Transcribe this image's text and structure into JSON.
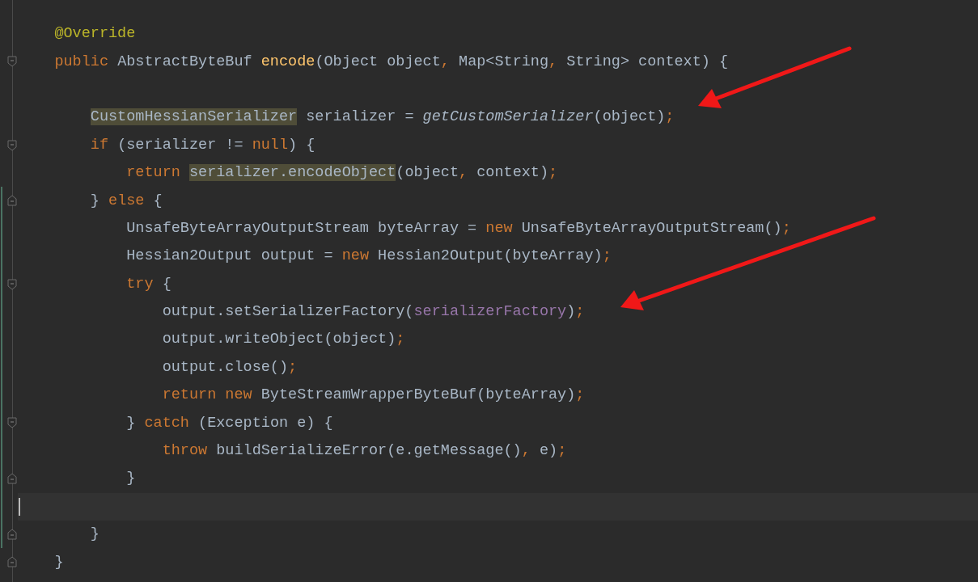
{
  "editor": {
    "lines": [
      {
        "fold_open": false,
        "fold_close": false,
        "changed": false,
        "current": false,
        "tokens": [
          {
            "text": "@Override",
            "kind": "annotation"
          }
        ]
      },
      {
        "fold_open": true,
        "fold_close": false,
        "changed": false,
        "current": false,
        "tokens": [
          {
            "text": "public ",
            "kind": "keyword"
          },
          {
            "text": "AbstractByteBuf ",
            "kind": "plain"
          },
          {
            "text": "encode",
            "kind": "declaration"
          },
          {
            "text": "(Object object",
            "kind": "plain"
          },
          {
            "text": ", ",
            "kind": "keyword"
          },
          {
            "text": "Map<String",
            "kind": "plain"
          },
          {
            "text": ", ",
            "kind": "keyword"
          },
          {
            "text": "String> context) {",
            "kind": "plain"
          }
        ],
        "children": [
          {
            "fold_open": false,
            "fold_close": false,
            "changed": false,
            "current": false
          },
          {
            "fold_open": false,
            "fold_close": false,
            "changed": false,
            "current": false,
            "tokens": [
              {
                "text": "CustomHessianSerializer",
                "kind": "usage"
              },
              {
                "text": " serializer = ",
                "kind": "plain"
              },
              {
                "text": "getCustomSerializer",
                "kind": "static"
              },
              {
                "text": "(object)",
                "kind": "plain"
              },
              {
                "text": ";",
                "kind": "keyword"
              }
            ]
          },
          {
            "fold_open": true,
            "fold_close": false,
            "changed": false,
            "current": false,
            "tokens": [
              {
                "text": "if ",
                "kind": "keyword"
              },
              {
                "text": "(serializer != ",
                "kind": "plain"
              },
              {
                "text": "null",
                "kind": "keyword"
              },
              {
                "text": ") {",
                "kind": "plain"
              }
            ],
            "children": [
              {
                "fold_open": false,
                "fold_close": false,
                "changed": false,
                "current": false,
                "tokens": [
                  {
                    "text": "return ",
                    "kind": "keyword"
                  },
                  {
                    "text": "serializer.encodeObject",
                    "kind": "usage"
                  },
                  {
                    "text": "(object",
                    "kind": "plain"
                  },
                  {
                    "text": ", ",
                    "kind": "keyword"
                  },
                  {
                    "text": "context)",
                    "kind": "plain"
                  },
                  {
                    "text": ";",
                    "kind": "keyword"
                  }
                ]
              }
            ]
          },
          {
            "fold_open": false,
            "fold_close": true,
            "changed": true,
            "current": false,
            "tokens": [
              {
                "text": "} ",
                "kind": "plain"
              },
              {
                "text": "else ",
                "kind": "keyword"
              },
              {
                "text": "{",
                "kind": "plain"
              }
            ],
            "children": [
              {
                "fold_open": false,
                "fold_close": false,
                "changed": true,
                "current": false,
                "tokens": [
                  {
                    "text": "UnsafeByteArrayOutputStream byteArray = ",
                    "kind": "plain"
                  },
                  {
                    "text": "new ",
                    "kind": "keyword"
                  },
                  {
                    "text": "UnsafeByteArrayOutputStream()",
                    "kind": "plain"
                  },
                  {
                    "text": ";",
                    "kind": "keyword"
                  }
                ]
              },
              {
                "fold_open": false,
                "fold_close": false,
                "changed": true,
                "current": false,
                "tokens": [
                  {
                    "text": "Hessian2Output output = ",
                    "kind": "plain"
                  },
                  {
                    "text": "new ",
                    "kind": "keyword"
                  },
                  {
                    "text": "Hessian2Output(byteArray)",
                    "kind": "plain"
                  },
                  {
                    "text": ";",
                    "kind": "keyword"
                  }
                ]
              },
              {
                "fold_open": true,
                "fold_close": false,
                "changed": true,
                "current": false,
                "tokens": [
                  {
                    "text": "try ",
                    "kind": "keyword"
                  },
                  {
                    "text": "{",
                    "kind": "plain"
                  }
                ],
                "children": [
                  {
                    "fold_open": false,
                    "fold_close": false,
                    "changed": true,
                    "current": false,
                    "tokens": [
                      {
                        "text": "output.setSerializerFactory(",
                        "kind": "plain"
                      },
                      {
                        "text": "serializerFactory",
                        "kind": "field"
                      },
                      {
                        "text": ")",
                        "kind": "plain"
                      },
                      {
                        "text": ";",
                        "kind": "keyword"
                      }
                    ]
                  },
                  {
                    "fold_open": false,
                    "fold_close": false,
                    "changed": true,
                    "current": false,
                    "tokens": [
                      {
                        "text": "output.writeObject(object)",
                        "kind": "plain"
                      },
                      {
                        "text": ";",
                        "kind": "keyword"
                      }
                    ]
                  },
                  {
                    "fold_open": false,
                    "fold_close": false,
                    "changed": true,
                    "current": false,
                    "tokens": [
                      {
                        "text": "output.close()",
                        "kind": "plain"
                      },
                      {
                        "text": ";",
                        "kind": "keyword"
                      }
                    ]
                  },
                  {
                    "fold_open": false,
                    "fold_close": false,
                    "changed": true,
                    "current": false,
                    "tokens": [
                      {
                        "text": "return new ",
                        "kind": "keyword"
                      },
                      {
                        "text": "ByteStreamWrapperByteBuf(byteArray)",
                        "kind": "plain"
                      },
                      {
                        "text": ";",
                        "kind": "keyword"
                      }
                    ]
                  }
                ]
              },
              {
                "fold_open": true,
                "fold_close": false,
                "changed": true,
                "current": false,
                "tokens": [
                  {
                    "text": "} ",
                    "kind": "plain"
                  },
                  {
                    "text": "catch ",
                    "kind": "keyword"
                  },
                  {
                    "text": "(Exception e) {",
                    "kind": "plain"
                  }
                ],
                "children": [
                  {
                    "fold_open": false,
                    "fold_close": false,
                    "changed": true,
                    "current": false,
                    "tokens": [
                      {
                        "text": "throw ",
                        "kind": "keyword"
                      },
                      {
                        "text": "buildSerializeError(e.getMessage()",
                        "kind": "plain"
                      },
                      {
                        "text": ", ",
                        "kind": "keyword"
                      },
                      {
                        "text": "e)",
                        "kind": "plain"
                      },
                      {
                        "text": ";",
                        "kind": "keyword"
                      }
                    ]
                  }
                ]
              },
              {
                "fold_open": false,
                "fold_close": true,
                "changed": true,
                "current": false,
                "tokens": [
                  {
                    "text": "}",
                    "kind": "plain"
                  }
                ]
              },
              {
                "fold_open": false,
                "fold_close": false,
                "changed": true,
                "current": true
              }
            ]
          },
          {
            "fold_open": false,
            "fold_close": true,
            "changed": true,
            "current": false,
            "tokens": [
              {
                "text": "}",
                "kind": "plain"
              }
            ]
          }
        ]
      },
      {
        "fold_open": false,
        "fold_close": true,
        "changed": false,
        "current": false,
        "tokens": [
          {
            "text": "}",
            "kind": "plain"
          }
        ]
      }
    ]
  }
}
